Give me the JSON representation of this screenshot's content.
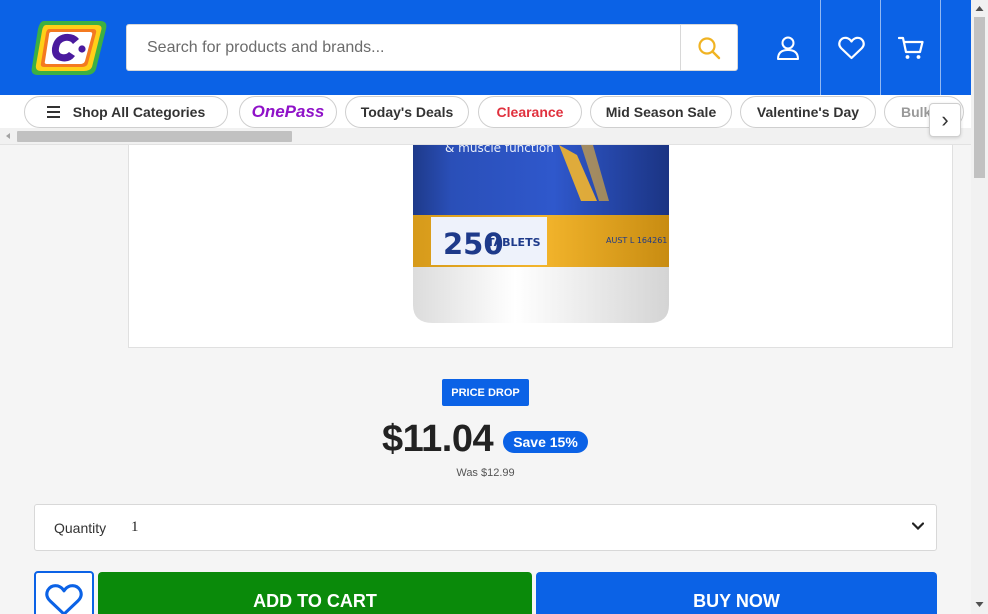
{
  "header": {
    "logo_letter": "C",
    "search_placeholder": "Search for products and brands...",
    "icons": [
      "account-icon",
      "wishlist-icon",
      "cart-icon"
    ]
  },
  "nav": {
    "shop_all": "Shop All Categories",
    "onepass": "OnePass",
    "todays_deals": "Today's Deals",
    "clearance": "Clearance",
    "mid_season": "Mid Season Sale",
    "valentines": "Valentine's Day",
    "bulk": "Bulk",
    "next_arrow": "›"
  },
  "product_image": {
    "tablet_count": "250",
    "tablet_word": "TABLETS",
    "aust_code": "AUST L 164261",
    "label_text": "& muscle function"
  },
  "price": {
    "badge": "PRICE DROP",
    "current": "$11.04",
    "save": "Save 15%",
    "was": "Was $12.99"
  },
  "quantity": {
    "label": "Quantity",
    "value": "1"
  },
  "actions": {
    "add_to_cart": "ADD TO CART",
    "buy_now": "BUY NOW"
  },
  "colors": {
    "brand_blue": "#0b62e6",
    "cart_green": "#0a8a0a",
    "clearance_red": "#e0313e",
    "onepass_purple": "#8f12c8",
    "logo_yellow": "#ffcf18",
    "logo_orange": "#f47a20",
    "logo_green": "#3cb043"
  }
}
